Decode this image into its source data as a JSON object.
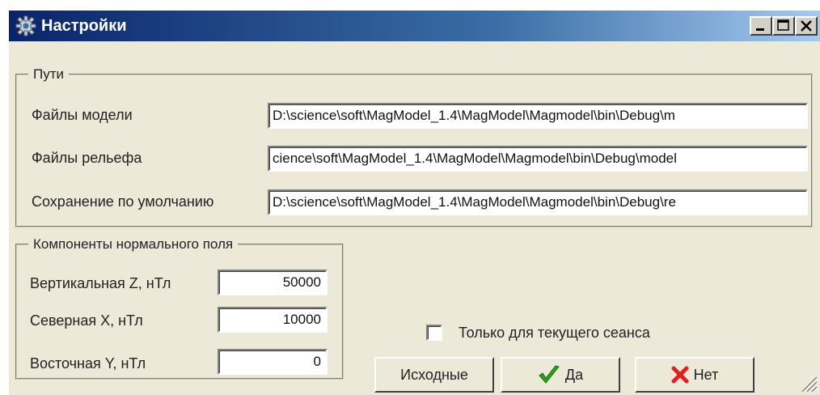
{
  "window": {
    "title": "Настройки"
  },
  "paths": {
    "legend": "Пути",
    "model_label": "Файлы модели",
    "model_value": "D:\\science\\soft\\MagModel_1.4\\MagModel\\Magmodel\\bin\\Debug\\m",
    "relief_label": "Файлы рельефа",
    "relief_value": "cience\\soft\\MagModel_1.4\\MagModel\\Magmodel\\bin\\Debug\\model",
    "save_label": "Сохранение по умолчанию",
    "save_value": "D:\\science\\soft\\MagModel_1.4\\MagModel\\Magmodel\\bin\\Debug\\re"
  },
  "field": {
    "legend": "Компоненты нормального поля",
    "z_label": "Вертикальная Z, нТл",
    "z_value": "50000",
    "x_label": "Северная X, нТл",
    "x_value": "10000",
    "y_label": "Восточная Y, нТл",
    "y_value": "0"
  },
  "session_only": {
    "label": "Только для текущего сеанса",
    "checked": false
  },
  "buttons": {
    "defaults": "Исходные",
    "yes": "Да",
    "no": "Нет"
  },
  "icons": {
    "title": "gear-icon",
    "yes": "checkmark-icon",
    "no": "cross-icon",
    "grip": "resize-grip-icon"
  },
  "colors": {
    "titlebar_start": "#0a246a",
    "titlebar_end": "#a6caf0",
    "yes_icon": "#2e9e1e",
    "no_icon": "#e02020",
    "dialog_bg": "#ece9d8"
  }
}
